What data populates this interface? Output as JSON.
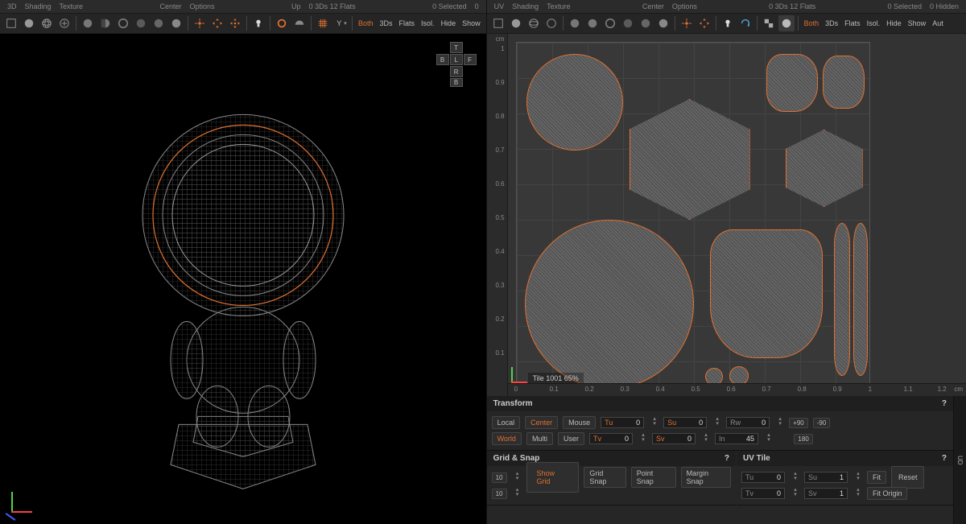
{
  "left_panel": {
    "menus": [
      "3D",
      "Shading",
      "Texture",
      "Center",
      "Options",
      "Up"
    ],
    "status": {
      "info": "0 3Ds 12 Flats",
      "selected": "0 Selected",
      "hidden": "0"
    },
    "toolbar": {
      "axis_letter": "Y",
      "mode_both": "Both",
      "mode_3ds": "3Ds",
      "mode_flats": "Flats",
      "mode_isol": "Isol.",
      "mode_hide": "Hide",
      "mode_show": "Show"
    },
    "cube": {
      "t": "T",
      "b": "B",
      "l": "L",
      "f": "F",
      "r": "R",
      "back": "B"
    }
  },
  "right_panel": {
    "menus": [
      "UV",
      "Shading",
      "Texture",
      "Center",
      "Options"
    ],
    "status": {
      "info": "0 3Ds 12 Flats",
      "selected": "0 Selected",
      "hidden": "0 Hidden"
    },
    "toolbar": {
      "mode_both": "Both",
      "mode_3ds": "3Ds",
      "mode_flats": "Flats",
      "mode_isol": "Isol.",
      "mode_hide": "Hide",
      "mode_show": "Show",
      "mode_aut": "Aut"
    },
    "ruler_v_unit": "cm",
    "ruler_v": [
      "1",
      "0.9",
      "0.8",
      "0.7",
      "0.6",
      "0.5",
      "0.4",
      "0.3",
      "0.2",
      "0.1"
    ],
    "ruler_h_unit": "cm",
    "ruler_h": [
      "0",
      "0.1",
      "0.2",
      "0.3",
      "0.4",
      "0.5",
      "0.6",
      "0.7",
      "0.8",
      "0.9",
      "1",
      "1.1",
      "1.2"
    ],
    "tile_label": "Tile 1001 65%"
  },
  "transform": {
    "title": "Transform",
    "help": "?",
    "space_local": "Local",
    "space_center": "Center",
    "space_mouse": "Mouse",
    "space_world": "World",
    "space_multi": "Multi",
    "space_user": "User",
    "tu": {
      "lbl": "Tu",
      "val": "0"
    },
    "tv": {
      "lbl": "Tv",
      "val": "0"
    },
    "su": {
      "lbl": "Su",
      "val": "0"
    },
    "sv": {
      "lbl": "Sv",
      "val": "0"
    },
    "rw": {
      "lbl": "Rw",
      "val": "0"
    },
    "in": {
      "lbl": "In",
      "val": "45"
    },
    "btn_p90": "+90",
    "btn_m90": "-90",
    "btn_180": "180"
  },
  "grid_snap": {
    "title": "Grid & Snap",
    "help": "?",
    "v1": "10",
    "v2": "10",
    "show_grid": "Show Grid",
    "grid_snap": "Grid Snap",
    "point_snap": "Point Snap",
    "margin_snap": "Margin Snap"
  },
  "uv_tile": {
    "title": "UV Tile",
    "help": "?",
    "tu": {
      "lbl": "Tu",
      "val": "0"
    },
    "tv": {
      "lbl": "Tv",
      "val": "0"
    },
    "su": {
      "lbl": "Su",
      "val": "1"
    },
    "sv": {
      "lbl": "Sv",
      "val": "1"
    },
    "fit": "Fit",
    "fit_origin": "Fit Origin",
    "reset": "Reset"
  },
  "side_tab": "UD"
}
